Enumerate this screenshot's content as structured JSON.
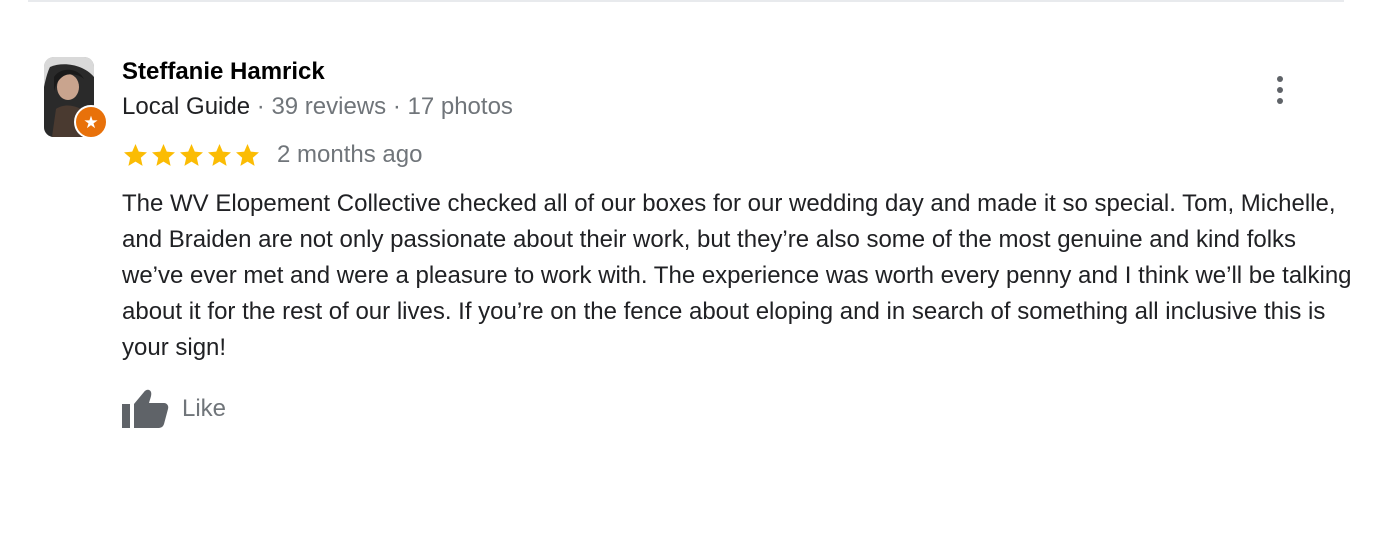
{
  "review": {
    "author": {
      "name": "Steffanie Hamrick",
      "guide_label": "Local Guide",
      "separator": "·",
      "reviews_count": "39 reviews",
      "photos_count": "17 photos",
      "badge_icon": "local-guide-star-icon",
      "badge_color": "#e8710a"
    },
    "rating": {
      "stars": 5,
      "max": 5,
      "star_color": "#fbbc04"
    },
    "date": "2 months ago",
    "text": "The WV Elopement Collective checked all of our boxes for our wedding day and made it so special. Tom, Michelle, and Braiden are not only passionate about their work, but they’re also some of the most genuine and kind folks we’ve ever met and were a pleasure to work with. The experience was worth every penny and I think we’ll be talking about it for the rest of our lives. If you’re on the fence about eloping and in search of something all inclusive this is your sign!",
    "actions": {
      "like_label": "Like",
      "like_icon": "thumbs-up-icon",
      "more_icon": "more-vert-icon"
    }
  }
}
